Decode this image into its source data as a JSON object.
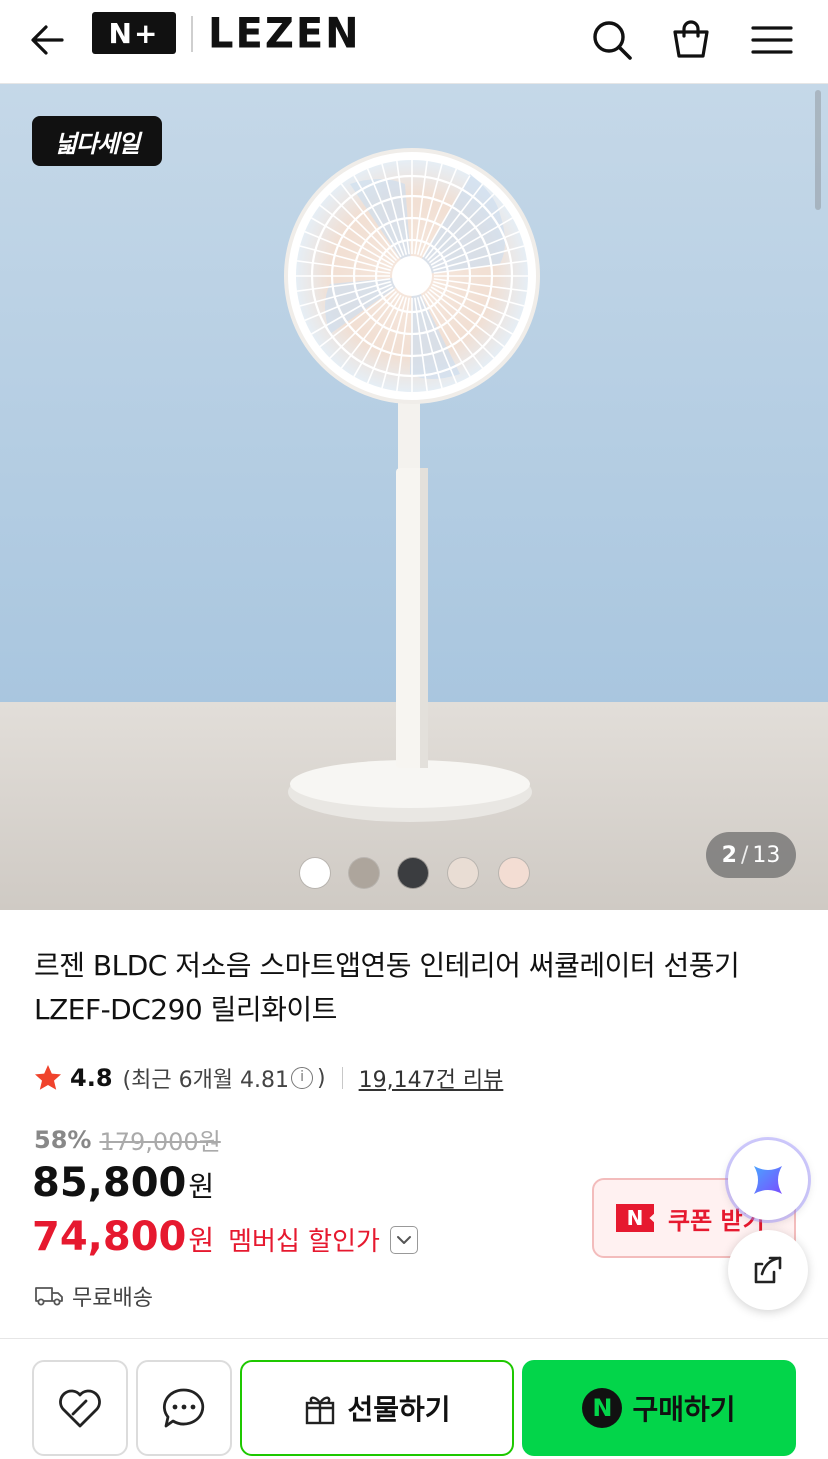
{
  "header": {
    "nplus_logo": "N+",
    "brand": "LEZEN",
    "icons": [
      "back-arrow-icon",
      "search-icon",
      "shopping-bag-icon",
      "menu-icon"
    ]
  },
  "hero": {
    "sale_badge": "넓다세일",
    "page_current": "2",
    "page_separator": "/",
    "page_total": "13",
    "swatches": [
      "#ffffff",
      "#ada59c",
      "#3b3d40",
      "#e9ddd4",
      "#f3ddd3"
    ],
    "active_swatch": 2
  },
  "product": {
    "title": "르젠 BLDC 저소음 스마트앱연동 인테리어 써큘레이터 선풍기 LZEF-DC290 릴리화이트",
    "rating": "4.8",
    "recent_rating": "(최근 6개월 4.81",
    "recent_close": ")",
    "info_icon": "i",
    "review_count": "19,147건 리뷰",
    "discount_percent": "58%",
    "original_price": "179,000원",
    "price": "85,800",
    "currency": "원",
    "member_price": "74,800",
    "member_label": "멤버십 할인가",
    "shipping": "무료배송"
  },
  "coupon": {
    "n_mark": "N",
    "label": "쿠폰 받기"
  },
  "bottom_bar": {
    "gift_label": "선물하기",
    "buy_n": "N",
    "buy_label": "구매하기"
  },
  "colors": {
    "accent_red": "#e6192f",
    "naver_green": "#03d54a",
    "gift_border": "#1ec800"
  }
}
